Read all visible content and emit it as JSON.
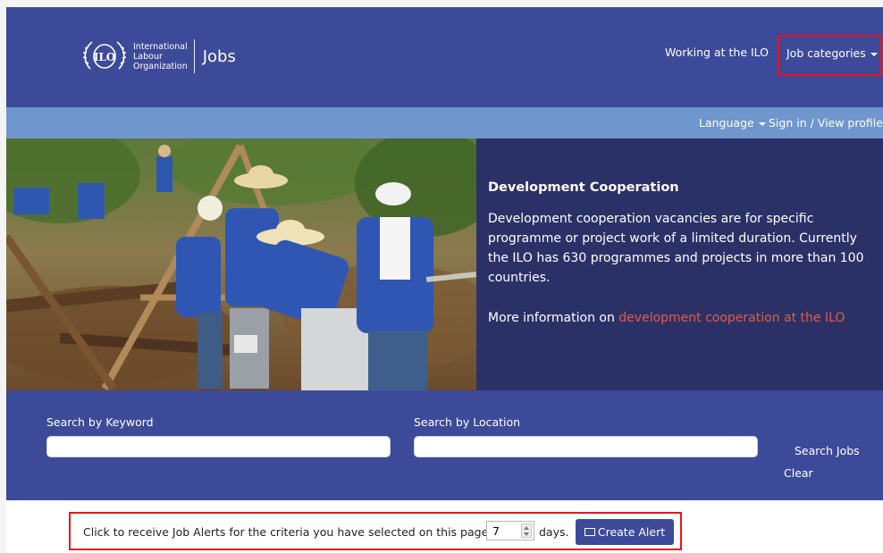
{
  "header": {
    "org_name_lines": [
      "International",
      "Labour",
      "Organization"
    ],
    "emblem_text": "ILO",
    "app_name": "Jobs",
    "nav_working": "Working at the ILO",
    "nav_job_categories": "Job categories"
  },
  "subbar": {
    "language": "Language",
    "sign_in": "Sign in / View profile"
  },
  "hero": {
    "title": "Development Cooperation",
    "text": "Development cooperation vacancies are for specific programme or project work of a limited duration. Currently the ILO has 630 programmes and projects in more than 100 countries.",
    "more_prefix": "More information on ",
    "more_link": "development cooperation at the ILO"
  },
  "search": {
    "keyword_label": "Search by Keyword",
    "keyword_value": "",
    "location_label": "Search by Location",
    "location_value": "",
    "search_button": "Search Jobs",
    "clear_button": "Clear"
  },
  "alert": {
    "text": "Click to receive Job Alerts for the criteria you have selected on this page every",
    "days_value": "7",
    "days_label": "days.",
    "create_button": "Create Alert"
  },
  "colors": {
    "header_blue": "#3c4a99",
    "subbar_blue": "#6f96cd",
    "hero_panel": "#2b3167",
    "link_orange": "#e45b42",
    "highlight_red": "#e8141c"
  }
}
